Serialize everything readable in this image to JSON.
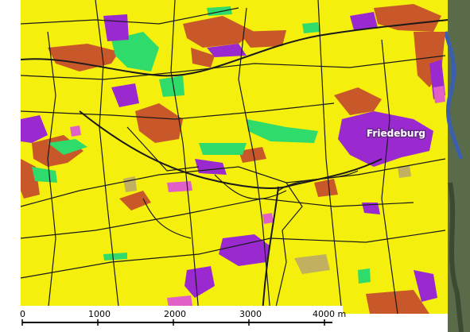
{
  "map": {
    "place_label": "Friedeburg",
    "scale_bar": {
      "ticks": [
        "0",
        "1000",
        "2000",
        "3000",
        "4000 m"
      ]
    },
    "legend_colors": {
      "arable_land": "#f5ef0d",
      "grassland": "#2fdb6a",
      "forest": "#c8582a",
      "settlement": "#9a2ad0",
      "industrial": "#e060c8",
      "water": "#3a5fb0",
      "special_crops": "#c0b060",
      "field_boundary": "#1a1a1a"
    }
  }
}
